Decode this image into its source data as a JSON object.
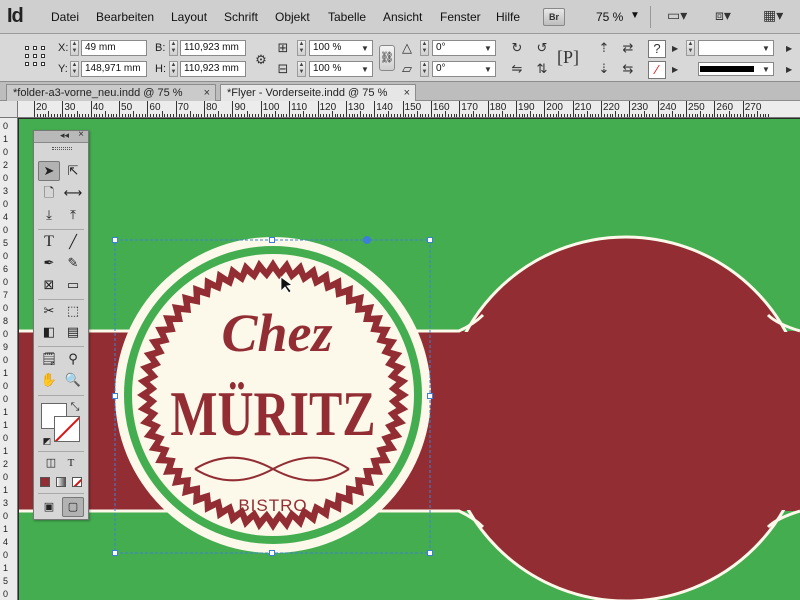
{
  "app": {
    "logo": "Id",
    "bridge_label": "Br",
    "zoom": "75 %"
  },
  "menu": [
    "Datei",
    "Bearbeiten",
    "Layout",
    "Schrift",
    "Objekt",
    "Tabelle",
    "Ansicht",
    "Fenster",
    "Hilfe"
  ],
  "control": {
    "x_label": "X:",
    "x_value": "49 mm",
    "y_label": "Y:",
    "y_value": "148,971 mm",
    "w_label": "B:",
    "w_value": "110,923 mm",
    "h_label": "H:",
    "h_value": "110,923 mm",
    "scale_x": "100 %",
    "scale_y": "100 %",
    "rotate": "0°",
    "shear": "0°"
  },
  "tabs": [
    {
      "label": "*folder-a3-vorne_neu.indd @ 75 %",
      "active": false
    },
    {
      "label": "*Flyer - Vorderseite.indd @ 75 %",
      "active": true
    }
  ],
  "close_glyph": "×",
  "ruler": {
    "h_labels": [
      "20",
      "30",
      "40",
      "50",
      "60",
      "70",
      "80",
      "90",
      "100",
      "110",
      "120",
      "130",
      "140",
      "150",
      "160",
      "170",
      "180",
      "190",
      "200",
      "210",
      "220",
      "230",
      "240",
      "250",
      "260",
      "270"
    ],
    "v_labels": [
      "0",
      "1",
      "0",
      "2",
      "0",
      "3",
      "0",
      "4",
      "0",
      "5",
      "0",
      "6",
      "0",
      "7",
      "0",
      "8",
      "0",
      "9",
      "0",
      "1",
      "0",
      "0",
      "1",
      "1",
      "0",
      "1",
      "2",
      "0",
      "1",
      "3",
      "0",
      "1",
      "4",
      "0",
      "1",
      "5",
      "0"
    ]
  },
  "logo": {
    "line1": "Chez",
    "line2": "MÜRITZ",
    "line3": "BISTRO"
  },
  "colors": {
    "canvas": "#43ad4f",
    "band": "#922d33",
    "cream": "#fcf8ea",
    "text": "#922d33",
    "selection": "#3d7fd6"
  },
  "tools": [
    "selection-tool",
    "direct-selection-tool",
    "page-tool",
    "gap-tool",
    "content-collector-tool",
    "content-placer-tool",
    "type-tool",
    "line-tool",
    "pen-tool",
    "pencil-tool",
    "rectangle-frame-tool",
    "rectangle-tool",
    "scissors-tool",
    "free-transform-tool",
    "gradient-swatch-tool",
    "gradient-feather-tool",
    "note-tool",
    "eyedropper-tool",
    "hand-tool",
    "zoom-tool"
  ]
}
